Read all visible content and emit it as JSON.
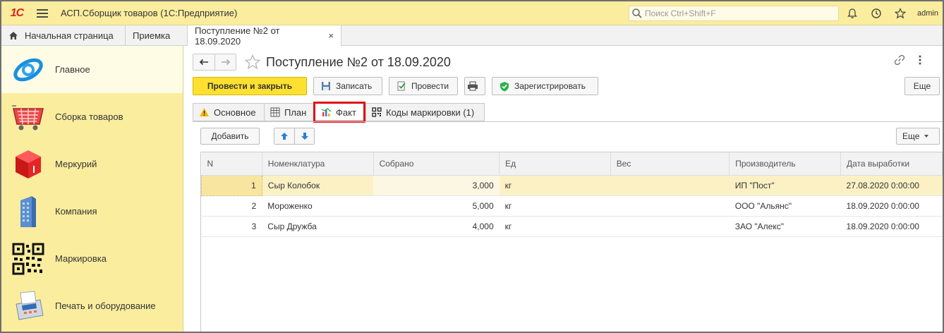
{
  "app": {
    "logo_text": "1С",
    "title": "АСП.Сборщик товаров  (1С:Предприятие)",
    "search_placeholder": "Поиск Ctrl+Shift+F",
    "user": "admin"
  },
  "tabs": [
    {
      "label": "Начальная страница"
    },
    {
      "label": "Приемка"
    },
    {
      "label": "Поступление №2 от 18.09.2020",
      "close": "×"
    }
  ],
  "sidebar": {
    "items": [
      {
        "label": "Главное",
        "icon": "main-section-icon"
      },
      {
        "label": "Сборка товаров",
        "icon": "basket-icon"
      },
      {
        "label": "Меркурий",
        "icon": "mercury-cube-icon"
      },
      {
        "label": "Компания",
        "icon": "building-icon"
      },
      {
        "label": "Маркировка",
        "icon": "qr-code-icon"
      },
      {
        "label": "Печать и оборудование",
        "icon": "terminal-icon"
      }
    ]
  },
  "document": {
    "title": "Поступление №2 от 18.09.2020"
  },
  "toolbar": {
    "post_close": "Провести и закрыть",
    "save": "Записать",
    "post": "Провести",
    "register": "Зарегистрировать",
    "more": "Еще"
  },
  "subtabs": [
    {
      "label": "Основное"
    },
    {
      "label": "План"
    },
    {
      "label": "Факт"
    },
    {
      "label": "Коды маркировки  (1)"
    }
  ],
  "table_toolbar": {
    "add": "Добавить",
    "more": "Еще"
  },
  "table": {
    "columns": [
      "N",
      "Номенклатура",
      "Собрано",
      "Ед",
      "Вес",
      "Производитель",
      "Дата выработки"
    ],
    "rows": [
      {
        "n": "1",
        "item": "Сыр Колобок",
        "collected": "3,000",
        "unit": "кг",
        "weight": "",
        "maker": "ИП \"Пост\"",
        "date": "27.08.2020 0:00:00"
      },
      {
        "n": "2",
        "item": "Мороженко",
        "collected": "5,000",
        "unit": "кг",
        "weight": "",
        "maker": "ООО \"Альянс\"",
        "date": "18.09.2020 0:00:00"
      },
      {
        "n": "3",
        "item": "Сыр Дружба",
        "collected": "4,000",
        "unit": "кг",
        "weight": "",
        "maker": "ЗАО \"Алекс\"",
        "date": "18.09.2020 0:00:00"
      }
    ]
  },
  "colors": {
    "accent_yellow": "#fbed9e",
    "primary_button": "#fde030",
    "highlight_red": "#e0101a"
  }
}
